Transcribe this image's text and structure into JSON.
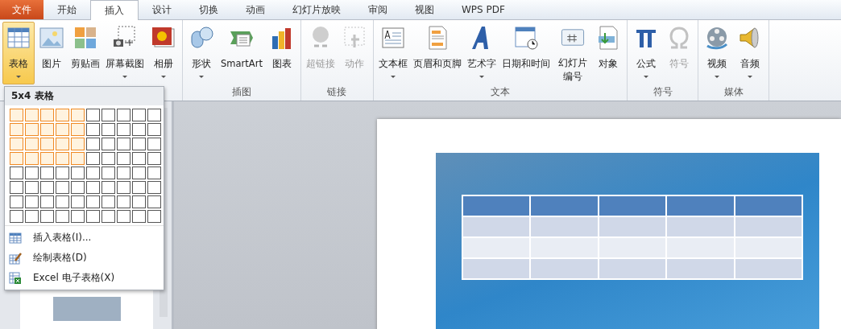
{
  "tabs": [
    {
      "label": "文件",
      "kind": "file",
      "selected": false
    },
    {
      "label": "开始",
      "kind": "tab",
      "selected": false
    },
    {
      "label": "插入",
      "kind": "tab",
      "selected": true
    },
    {
      "label": "设计",
      "kind": "tab",
      "selected": false
    },
    {
      "label": "切换",
      "kind": "tab",
      "selected": false
    },
    {
      "label": "动画",
      "kind": "tab",
      "selected": false
    },
    {
      "label": "幻灯片放映",
      "kind": "tab",
      "selected": false
    },
    {
      "label": "审阅",
      "kind": "tab",
      "selected": false
    },
    {
      "label": "视图",
      "kind": "tab",
      "selected": false
    },
    {
      "label": "WPS PDF",
      "kind": "tab",
      "selected": false
    }
  ],
  "ribbon_groups": [
    {
      "items": [
        {
          "label": "表格",
          "dropdown": true,
          "disabled": false,
          "selected": true
        },
        {
          "label": "图片",
          "dropdown": false,
          "disabled": false,
          "selected": false
        },
        {
          "label": "剪贴画",
          "dropdown": false,
          "disabled": false,
          "selected": false
        },
        {
          "label": "屏幕截图",
          "dropdown": true,
          "disabled": false,
          "selected": false
        },
        {
          "label": "相册",
          "dropdown": true,
          "disabled": false,
          "selected": false
        }
      ]
    },
    {
      "label": "插图",
      "items": [
        {
          "label": "形状",
          "dropdown": true,
          "disabled": false,
          "selected": false
        },
        {
          "label": "SmartArt",
          "dropdown": false,
          "disabled": false,
          "selected": false
        },
        {
          "label": "图表",
          "dropdown": false,
          "disabled": false,
          "selected": false
        }
      ]
    },
    {
      "label": "链接",
      "items": [
        {
          "label": "超链接",
          "dropdown": false,
          "disabled": true,
          "selected": false
        },
        {
          "label": "动作",
          "dropdown": false,
          "disabled": true,
          "selected": false
        }
      ]
    },
    {
      "label": "文本",
      "items": [
        {
          "label": "文本框",
          "dropdown": true,
          "disabled": false,
          "selected": false
        },
        {
          "label": "页眉和页脚",
          "dropdown": false,
          "disabled": false,
          "selected": false
        },
        {
          "label": "艺术字",
          "dropdown": true,
          "disabled": false,
          "selected": false
        },
        {
          "label": "日期和时间",
          "dropdown": false,
          "disabled": false,
          "selected": false
        },
        {
          "label": "幻灯片编号",
          "narrow": true,
          "dropdown": false,
          "disabled": false,
          "selected": false
        },
        {
          "label": "对象",
          "dropdown": false,
          "disabled": false,
          "selected": false
        }
      ]
    },
    {
      "label": "符号",
      "items": [
        {
          "label": "公式",
          "dropdown": true,
          "disabled": false,
          "selected": false
        },
        {
          "label": "符号",
          "dropdown": false,
          "disabled": true,
          "selected": false
        }
      ]
    },
    {
      "label": "媒体",
      "items": [
        {
          "label": "视频",
          "dropdown": true,
          "disabled": false,
          "selected": false
        },
        {
          "label": "音频",
          "dropdown": true,
          "disabled": false,
          "selected": false
        }
      ]
    }
  ],
  "table_menu": {
    "title": "5x4 表格",
    "grid": [
      {
        "cells": [
          {
            "selected": true
          },
          {
            "selected": true
          },
          {
            "selected": true
          },
          {
            "selected": true
          },
          {
            "selected": true
          },
          {
            "selected": false
          },
          {
            "selected": false
          },
          {
            "selected": false
          },
          {
            "selected": false
          },
          {
            "selected": false
          }
        ]
      },
      {
        "cells": [
          {
            "selected": true
          },
          {
            "selected": true
          },
          {
            "selected": true
          },
          {
            "selected": true
          },
          {
            "selected": true
          },
          {
            "selected": false
          },
          {
            "selected": false
          },
          {
            "selected": false
          },
          {
            "selected": false
          },
          {
            "selected": false
          }
        ]
      },
      {
        "cells": [
          {
            "selected": true
          },
          {
            "selected": true
          },
          {
            "selected": true
          },
          {
            "selected": true
          },
          {
            "selected": true
          },
          {
            "selected": false
          },
          {
            "selected": false
          },
          {
            "selected": false
          },
          {
            "selected": false
          },
          {
            "selected": false
          }
        ]
      },
      {
        "cells": [
          {
            "selected": true
          },
          {
            "selected": true
          },
          {
            "selected": true
          },
          {
            "selected": true
          },
          {
            "selected": true
          },
          {
            "selected": false
          },
          {
            "selected": false
          },
          {
            "selected": false
          },
          {
            "selected": false
          },
          {
            "selected": false
          }
        ]
      },
      {
        "cells": [
          {
            "selected": false
          },
          {
            "selected": false
          },
          {
            "selected": false
          },
          {
            "selected": false
          },
          {
            "selected": false
          },
          {
            "selected": false
          },
          {
            "selected": false
          },
          {
            "selected": false
          },
          {
            "selected": false
          },
          {
            "selected": false
          }
        ]
      },
      {
        "cells": [
          {
            "selected": false
          },
          {
            "selected": false
          },
          {
            "selected": false
          },
          {
            "selected": false
          },
          {
            "selected": false
          },
          {
            "selected": false
          },
          {
            "selected": false
          },
          {
            "selected": false
          },
          {
            "selected": false
          },
          {
            "selected": false
          }
        ]
      },
      {
        "cells": [
          {
            "selected": false
          },
          {
            "selected": false
          },
          {
            "selected": false
          },
          {
            "selected": false
          },
          {
            "selected": false
          },
          {
            "selected": false
          },
          {
            "selected": false
          },
          {
            "selected": false
          },
          {
            "selected": false
          },
          {
            "selected": false
          }
        ]
      },
      {
        "cells": [
          {
            "selected": false
          },
          {
            "selected": false
          },
          {
            "selected": false
          },
          {
            "selected": false
          },
          {
            "selected": false
          },
          {
            "selected": false
          },
          {
            "selected": false
          },
          {
            "selected": false
          },
          {
            "selected": false
          },
          {
            "selected": false
          }
        ]
      }
    ],
    "items": [
      {
        "label": "插入表格(I)...",
        "kind": "insert"
      },
      {
        "label": "绘制表格(D)",
        "kind": "draw"
      },
      {
        "label": "Excel 电子表格(X)",
        "kind": "excel"
      }
    ]
  }
}
